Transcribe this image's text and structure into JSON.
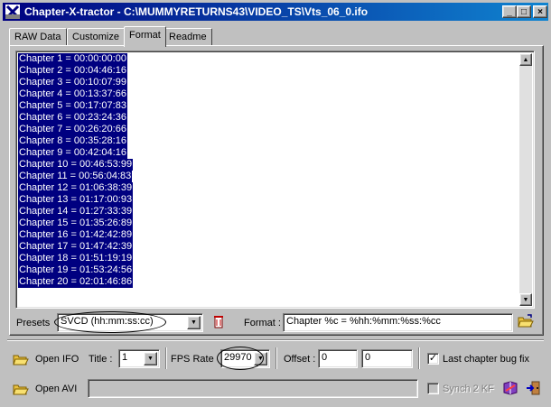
{
  "window": {
    "title": "Chapter-X-tractor - C:\\MUMMYRETURNS43\\VIDEO_TS\\Vts_06_0.ifo",
    "app_icon": "chapter-x-tractor-icon",
    "controls": {
      "minimize": "_",
      "maximize": "□",
      "close": "×"
    }
  },
  "tabs": [
    {
      "label": "RAW Data"
    },
    {
      "label": "Customize"
    },
    {
      "label": "Format",
      "active": true
    },
    {
      "label": "Readme"
    }
  ],
  "chapters": [
    "Chapter 1 = 00:00:00:00",
    "Chapter 2 = 00:04:46:16",
    "Chapter 3 = 00:10:07:99",
    "Chapter 4 = 00:13:37:66",
    "Chapter 5 = 00:17:07:83",
    "Chapter 6 = 00:23:24:36",
    "Chapter 7 = 00:26:20:66",
    "Chapter 8 = 00:35:28:16",
    "Chapter 9 = 00:42:04:16",
    "Chapter 10 = 00:46:53:99",
    "Chapter 11 = 00:56:04:83",
    "Chapter 12 = 01:06:38:39",
    "Chapter 13 = 01:17:00:93",
    "Chapter 14 = 01:27:33:39",
    "Chapter 15 = 01:35:26:89",
    "Chapter 16 = 01:42:42:89",
    "Chapter 17 = 01:47:42:39",
    "Chapter 18 = 01:51:19:19",
    "Chapter 19 = 01:53:24:56",
    "Chapter 20 = 02:01:46:86"
  ],
  "format_panel": {
    "presets_label": "Presets",
    "preset_value": "SVCD (hh:mm:ss:cc)",
    "format_label": "Format :",
    "format_value": "Chapter %c = %hh:%mm:%ss:%cc"
  },
  "ifo_row": {
    "open_ifo_label": "Open IFO",
    "title_label": "Title :",
    "title_value": "1",
    "fps_label": "FPS Rate",
    "fps_value": "29970",
    "offset_label": "Offset :",
    "offset_value_1": "0",
    "offset_value_2": "0",
    "last_chapter_fix_label": "Last chapter bug fix",
    "last_chapter_fix_checked": "✓"
  },
  "avi_row": {
    "open_avi_label": "Open AVI",
    "avi_path": "",
    "synch_label": "Synch 2 KF"
  },
  "colors": {
    "selection": "#000080",
    "titlebar_start": "#000080",
    "titlebar_end": "#1084d0",
    "face": "#c0c0c0"
  }
}
